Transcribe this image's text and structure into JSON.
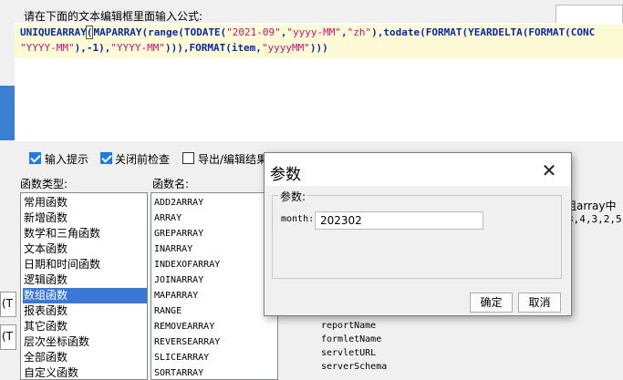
{
  "header": {
    "prompt": "请在下面的文本编辑框里面输入公式:"
  },
  "formula": {
    "line1_a": "UNIQUEARRAY",
    "line1_paren": "(",
    "line1_b": "MAPARRAY(range(TODATE(",
    "line1_s1": "\"2021-09\"",
    "line1_c": ",",
    "line1_s2": "\"yyyy-MM\"",
    "line1_d": ",",
    "line1_s3": "\"zh\"",
    "line1_e": "),todate(FORMAT(YEARDELTA(FORMAT(CONC",
    "line2_s1": "\"YYYY-MM\"",
    "line2_a": "),-1),",
    "line2_s2": "\"YYYY-MM\"",
    "line2_b": "))),FORMAT(item,",
    "line2_s3": "\"yyyyMM\"",
    "line2_c": ")))"
  },
  "options": {
    "input_hint": "输入提示",
    "check_before_close": "关闭前检查",
    "export_edit": "导出/编辑结果"
  },
  "function_types": {
    "header": "函数类型:",
    "items": [
      "常用函数",
      "新增函数",
      "数学和三角函数",
      "文本函数",
      "日期和时间函数",
      "逻辑函数",
      "数组函数",
      "报表函数",
      "其它函数",
      "层次坐标函数",
      "全部函数",
      "自定义函数"
    ],
    "selected_index": 6
  },
  "function_names": {
    "header": "函数名:",
    "items": [
      "ADD2ARRAY",
      "ARRAY",
      "GREPARRAY",
      "INARRAY",
      "INDEXOFARRAY",
      "JOINARRAY",
      "MAPARRAY",
      "RANGE",
      "REMOVEARRAY",
      "REVERSEARRAY",
      "SLICEARRAY",
      "SORTARRAY"
    ]
  },
  "description": {
    "line1": "组array中",
    "line2": "3,4,3,2,5,"
  },
  "params_tree": {
    "items": [
      "reportName",
      "formletName",
      "servletURL",
      "serverSchema"
    ]
  },
  "left_fragments": {
    "a": "(T",
    "b": "(T"
  },
  "dialog": {
    "title": "参数",
    "close": "✕",
    "group_label": "参数:",
    "month_label": "month:",
    "month_value": "202302",
    "ok": "确定",
    "cancel": "取消"
  },
  "colors": {
    "selection": "#3a78d8",
    "keyword": "#0a28a8",
    "string": "#c8117a",
    "checkbox": "#1e7be0"
  }
}
